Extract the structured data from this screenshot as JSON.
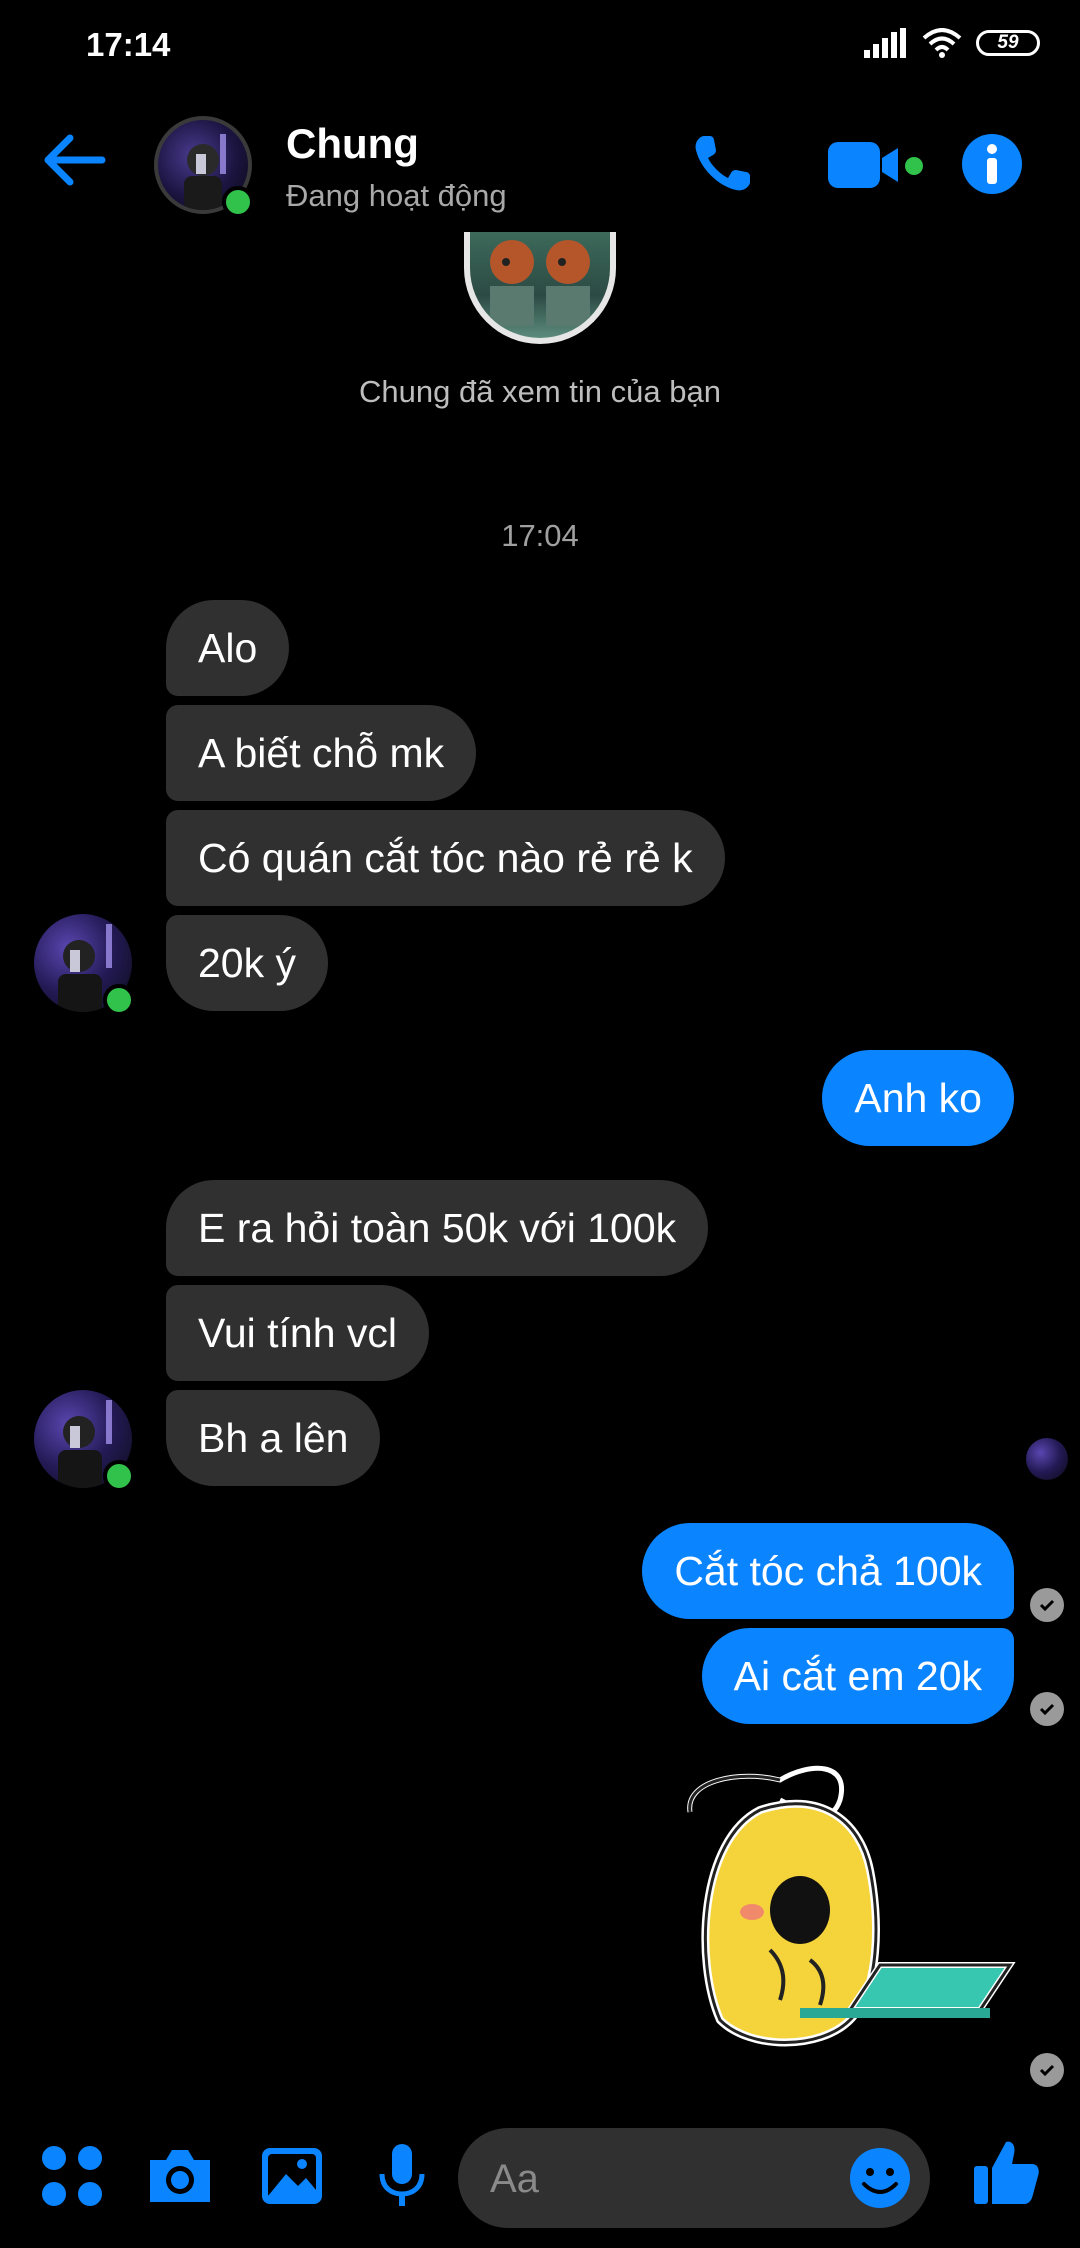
{
  "status_bar": {
    "time": "17:14",
    "battery": "59"
  },
  "header": {
    "name": "Chung",
    "status": "Đang hoạt động"
  },
  "seen_text": "Chung đã xem tin của bạn",
  "timestamp": "17:04",
  "messages": [
    {
      "text": "Alo",
      "from": "them"
    },
    {
      "text": "A biết chỗ mk",
      "from": "them"
    },
    {
      "text": "Có quán cắt tóc nào rẻ rẻ k",
      "from": "them"
    },
    {
      "text": "20k ý",
      "from": "them"
    },
    {
      "text": "Anh ko",
      "from": "me"
    },
    {
      "text": "E ra hỏi toàn 50k với 100k",
      "from": "them"
    },
    {
      "text": "Vui tính vcl",
      "from": "them"
    },
    {
      "text": "Bh a lên",
      "from": "them"
    },
    {
      "text": "Cắt tóc chả 100k",
      "from": "me"
    },
    {
      "text": "Ai cắt em 20k",
      "from": "me"
    }
  ],
  "composer": {
    "placeholder": "Aa"
  },
  "icons": {
    "back": "arrow-left-icon",
    "call": "phone-icon",
    "video": "video-camera-icon",
    "info": "info-icon",
    "apps": "four-dots-icon",
    "camera": "camera-icon",
    "gallery": "image-icon",
    "mic": "microphone-icon",
    "emoji": "smiley-icon",
    "like": "thumbs-up-icon"
  },
  "colors": {
    "accent": "#0a84ff",
    "incoming_bubble": "#303030",
    "online": "#31c24b",
    "background": "#000000"
  }
}
